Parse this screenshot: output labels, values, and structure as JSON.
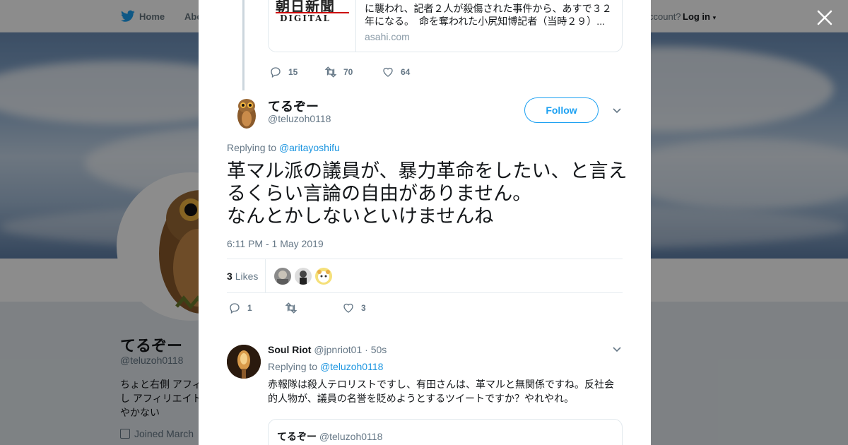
{
  "nav": {
    "home_label": "Home",
    "about_label": "Abo",
    "account_prompt": "ccount?",
    "login_label": "Log in"
  },
  "profile": {
    "name": "てるぞー",
    "handle": "@teluzoh0118",
    "bio": "ちょと右側 アフィ\nし アフィリエイト\nやかない",
    "joined": "Joined March"
  },
  "link_card": {
    "text": "に襲われ、記者２人が殺傷された事件から、あすで３２年になる。　命を奪われた小尻知博記者（当時２９）...",
    "domain": "asahi.com",
    "logo_top": "朝日新聞",
    "logo_bottom": "DIGITAL"
  },
  "prev_tweet_actions": {
    "replies": "15",
    "retweets": "70",
    "likes": "64"
  },
  "tweet": {
    "name": "てるぞー",
    "handle": "@teluzoh0118",
    "follow_label": "Follow",
    "replying_prefix": "Replying to ",
    "replying_to": "@aritayoshifu",
    "text": "革マル派の議員が、暴力革命をしたい、と言えるくらい言論の自由がありません。\nなんとかしないといけませんね",
    "time": "6:11 PM - 1 May 2019",
    "likes_count": "3",
    "likes_label": "Likes",
    "replies": "1",
    "retweets": "",
    "likes": "3"
  },
  "reply": {
    "name": "Soul Riot",
    "handle": "@jpnriot01",
    "time": "· 50s",
    "replying_prefix": "Replying to ",
    "replying_to": "@teluzoh0118",
    "text": "赤報隊は殺人テロリストですし、有田さんは、革マルと無関係ですね。反社会的人物が、議員の名誉を貶めようとするツイートですか？やれやれ。",
    "quote_name": "てるぞー",
    "quote_handle": "@teluzoh0118"
  },
  "colors": {
    "accent": "#1da1f2",
    "link": "#1b95e0",
    "muted": "#657786"
  }
}
